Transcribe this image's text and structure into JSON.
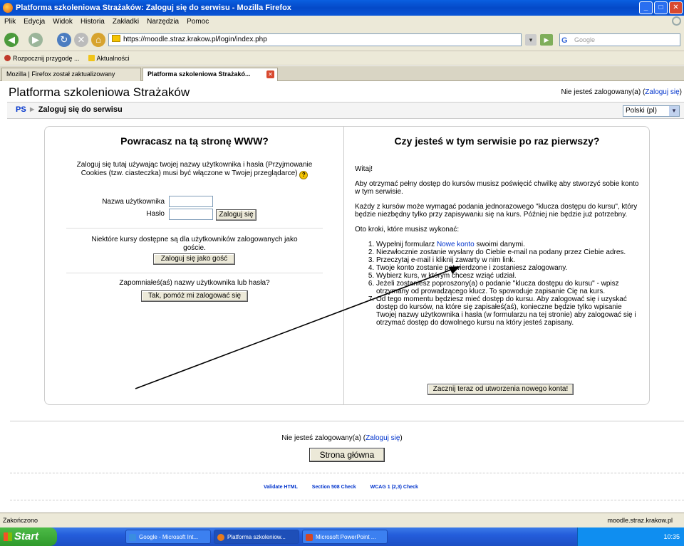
{
  "window": {
    "title": "Platforma szkoleniowa Strażaków: Zaloguj się do serwisu - Mozilla Firefox"
  },
  "menu": [
    "Plik",
    "Edycja",
    "Widok",
    "Historia",
    "Zakładki",
    "Narzędzia",
    "Pomoc"
  ],
  "address": {
    "url": "https://moodle.straz.krakow.pl/login/index.php"
  },
  "search": {
    "engine_icon": "G",
    "placeholder": "Google"
  },
  "bookmarks": [
    {
      "label": "Rozpocznij przygodę ...",
      "icon": "firefox-icon"
    },
    {
      "label": "Aktualności",
      "icon": "folder-icon"
    }
  ],
  "tabs": [
    {
      "label": "Mozilla | Firefox został zaktualizowany",
      "active": false
    },
    {
      "label": "Platforma szkoleniowa Strażakó...",
      "active": true
    }
  ],
  "page": {
    "site_title": "Platforma szkoleniowa Strażaków",
    "login_status": {
      "text": "Nie jesteś zalogowany(a) (",
      "link": "Zaloguj się",
      "suffix": ")"
    },
    "breadcrumb": {
      "home": "PS",
      "separator": "►",
      "current": "Zaloguj się do serwisu"
    },
    "language": "Polski (pl)"
  },
  "left": {
    "heading": "Powracasz na tą stronę WWW?",
    "intro": "Zaloguj się tutaj używając twojej nazwy użytkownika i hasła (Przyjmowanie Cookies (tzw. ciasteczka) musi być włączone w Twojej przeglądarce)",
    "help_icon": "?",
    "username_label": "Nazwa użytkownika",
    "password_label": "Hasło",
    "login_button": "Zaloguj się",
    "guest_text": "Niektóre kursy dostępne są dla użytkowników zalogowanych jako goście.",
    "guest_button": "Zaloguj się jako gość",
    "forgot_text": "Zapomniałeś(aś) nazwy użytkownika lub hasła?",
    "forgot_button": "Tak, pomóż mi zalogować się"
  },
  "right": {
    "heading": "Czy jesteś w tym serwisie po raz pierwszy?",
    "welcome": "Witaj!",
    "p1": "Aby otrzymać pełny dostęp do kursów musisz poświęcić chwilkę aby stworzyć sobie konto w tym serwisie.",
    "p2": "Każdy z kursów może wymagać podania jednorazowego \"klucza dostępu do kursu\", który będzie niezbędny tylko przy zapisywaniu się na kurs. Później nie będzie już potrzebny.",
    "p3": "Oto kroki, które musisz wykonać:",
    "step1_pre": "Wypełnij formularz ",
    "step1_link": "Nowe konto",
    "step1_post": " swoimi danymi.",
    "step2": "Niezwłocznie zostanie wysłany do Ciebie e-mail na podany przez Ciebie adres.",
    "step3": "Przeczytaj e-mail i kliknij zawarty w nim link.",
    "step4": "Twoje konto zostanie potwierdzone i zostaniesz zalogowany.",
    "step5": "Wybierz kurs, w którym chcesz wziąć udział.",
    "step6": "Jeżeli zostaniesz poproszony(a) o podanie \"klucza dostępu do kursu\" - wpisz otrzymany od prowadzącego klucz. To spowoduje zapisanie Cię na kurs.",
    "step7": "Od tego momentu będziesz mieć dostęp do kursu. Aby zalogować się i uzyskać dostęp do kursów, na które się zapisałeś(aś), konieczne będzie tylko wpisanie Twojej nazwy użytkownika i hasła (w formularzu na tej stronie) aby zalogować się i otrzymać dostęp do dowolnego kursu na który jesteś zapisany.",
    "signup_button": "Zacznij teraz od utworzenia nowego konta!"
  },
  "footer": {
    "login_text": "Nie jesteś zalogowany(a) (",
    "login_link": "Zaloguj się",
    "login_suffix": ")",
    "home_button": "Strona główna",
    "validators": [
      "Validate HTML",
      "Section 508 Check",
      "WCAG 1 (2,3) Check"
    ]
  },
  "status": {
    "text": "Zakończono",
    "host": "moodle.straz.krakow.pl"
  },
  "taskbar": {
    "start": "Start",
    "items": [
      {
        "label": "Google - Microsoft Int...",
        "active": false
      },
      {
        "label": "Platforma szkoleniow...",
        "active": true
      },
      {
        "label": "Microsoft PowerPoint ...",
        "active": false
      }
    ],
    "clock": "10:35"
  },
  "colors": {
    "link": "#0033cc",
    "titlebar": "#0449c8",
    "arrow": "#000000"
  }
}
